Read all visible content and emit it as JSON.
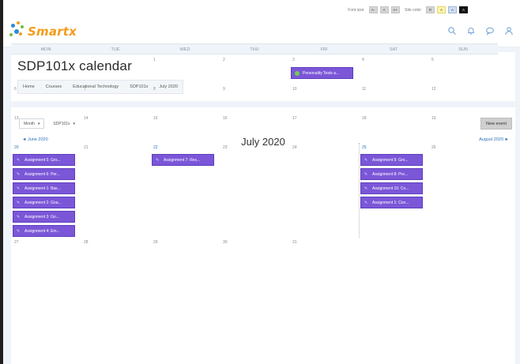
{
  "accessibility": {
    "font_size_label": "Font size",
    "font_buttons": [
      "A-",
      "A",
      "A+"
    ],
    "site_color_label": "Site color",
    "color_buttons": [
      "R",
      "A",
      "A",
      "A"
    ]
  },
  "brand": {
    "name": "Smartx",
    "accent": "#f39c1b"
  },
  "nav_icons": [
    "search-icon",
    "bell-icon",
    "chat-icon",
    "user-menu-icon"
  ],
  "page": {
    "title": "SDP101x calendar",
    "breadcrumb": [
      "Home",
      "Courses",
      "Educational Technology",
      "SDP101x",
      "July 2020"
    ]
  },
  "calendar": {
    "view_select": "Month",
    "course_select": "SDP101x",
    "new_event_label": "New event",
    "prev_label": "◄ June 2020",
    "next_label": "August 2020 ►",
    "month_title": "July 2020",
    "days": [
      "MON",
      "TUE",
      "WED",
      "THU",
      "FRI",
      "SAT",
      "SUN"
    ],
    "event_color": "#7b57d8",
    "weeks": [
      {
        "dates": [
          "",
          "",
          "1",
          "2",
          "3",
          "4",
          "5"
        ]
      },
      {
        "dates": [
          "6",
          "7",
          "8",
          "9",
          "10",
          "11",
          "12"
        ]
      },
      {
        "dates": [
          "13",
          "14",
          "15",
          "16",
          "17",
          "18",
          "19"
        ]
      },
      {
        "dates": [
          "20",
          "21",
          "22",
          "23",
          "24",
          "25",
          "26"
        ]
      },
      {
        "dates": [
          "27",
          "28",
          "29",
          "30",
          "31",
          "",
          ""
        ]
      }
    ],
    "events": {
      "fri3": [
        "Personality Tests a..."
      ],
      "mon20": [
        "Assignment 5: Gro...",
        "Assignment 6: Per...",
        "Assignment 1: Bas...",
        "Assignment 2: Goa...",
        "Assignment 3: Go...",
        "Assignment 4: Em..."
      ],
      "wed22": [
        "Assignment 7: Res..."
      ],
      "sat25": [
        "Assignment 9: Gro...",
        "Assignment 8: Pre...",
        "Assignment 10: Co...",
        "Assignment 1: Con..."
      ]
    }
  }
}
